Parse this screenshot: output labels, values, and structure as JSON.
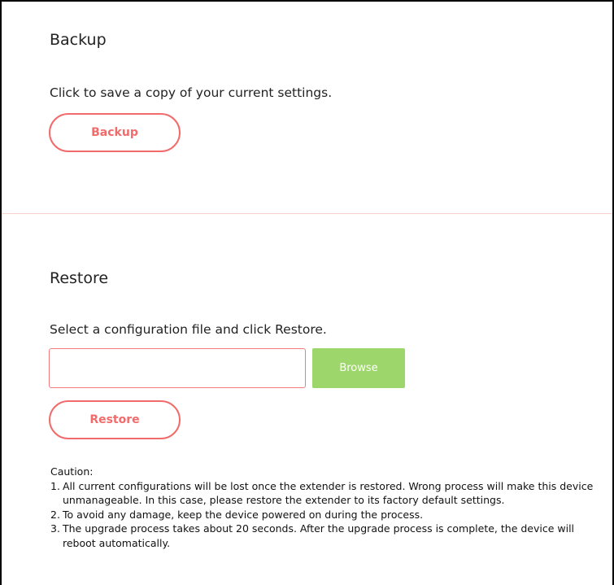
{
  "backup": {
    "title": "Backup",
    "description": "Click to save a copy of your current settings.",
    "button_label": "Backup"
  },
  "restore": {
    "title": "Restore",
    "description": "Select a configuration file and click Restore.",
    "file_input": {
      "value": "",
      "placeholder": ""
    },
    "browse_label": "Browse",
    "button_label": "Restore"
  },
  "caution": {
    "title": "Caution:",
    "items": [
      {
        "number": "1.",
        "text": "All current configurations will be lost once the extender is restored. Wrong process will make this device unmanageable. In this case, please restore the extender to its factory default settings."
      },
      {
        "number": "2.",
        "text": "To avoid any damage, keep the device powered on during the process."
      },
      {
        "number": "3.",
        "text": "The upgrade process takes about 20 seconds. After the upgrade process is complete, the device will reboot automatically."
      }
    ]
  },
  "colors": {
    "accent": "#f26b6b",
    "browse_button": "#9dd66a",
    "divider": "#f6d3cc"
  }
}
